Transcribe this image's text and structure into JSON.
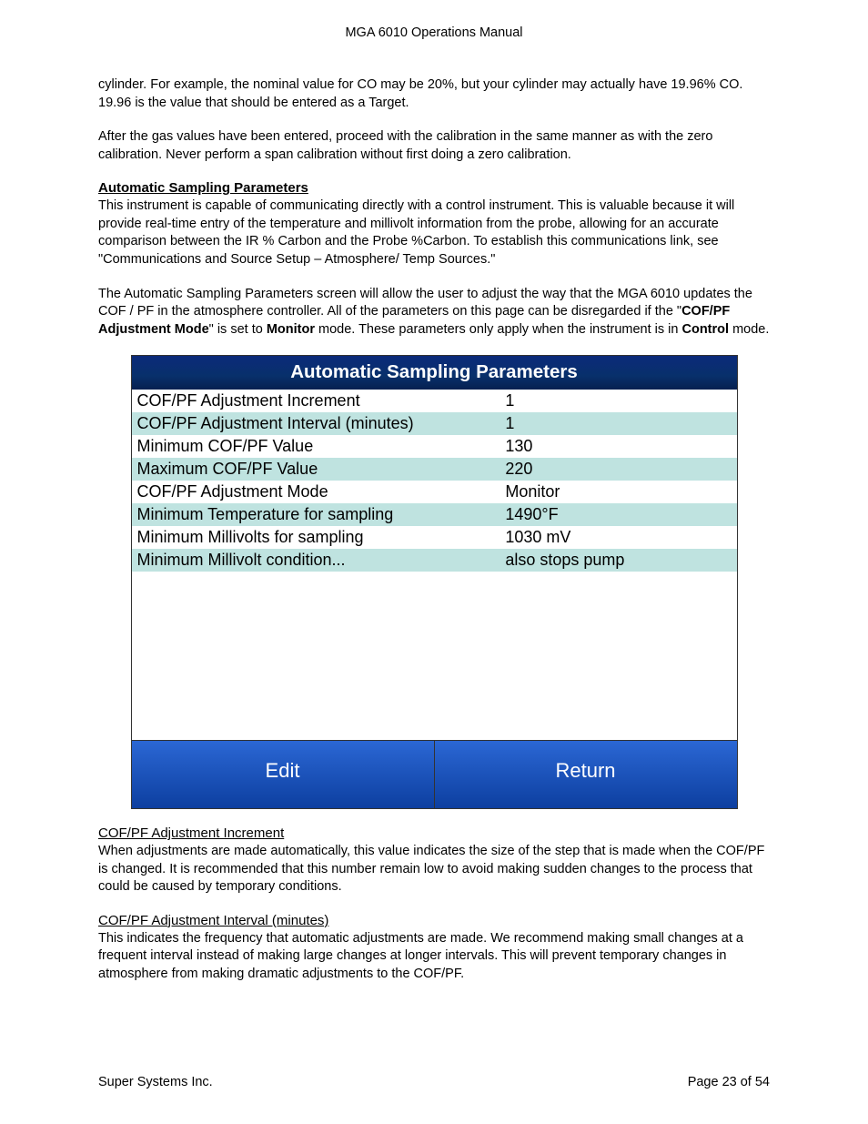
{
  "header": {
    "title": "MGA 6010 Operations Manual"
  },
  "body": {
    "para_top": "cylinder.  For example, the nominal value for CO may be 20%, but your cylinder may actually have 19.96% CO.  19.96 is the value that should be entered as a Target.",
    "para_after_gas": "After the gas values have been entered, proceed with the calibration in the same manner as with the zero calibration.  Never perform a span calibration without first doing a zero calibration.",
    "section_title": "Automatic Sampling Parameters",
    "para_intro1": "This instrument is capable of communicating directly with a control instrument.  This is valuable because it will provide real-time entry of the temperature and millivolt information from the probe, allowing for an accurate comparison between the IR % Carbon and the Probe %Carbon.  To establish this communications link, see \"Communications and Source Setup – Atmosphere/ Temp Sources.\"",
    "para_intro2_a": "The Automatic Sampling Parameters screen will allow the user to adjust the way that the MGA 6010 updates the COF / PF in the atmosphere controller.  All of the parameters on this page can be disregarded if the \"",
    "para_intro2_bold1": "COF/PF Adjustment Mode",
    "para_intro2_b": "\" is set to ",
    "para_intro2_bold2": "Monitor",
    "para_intro2_c": " mode.  These parameters only apply when the instrument is in ",
    "para_intro2_bold3": "Control",
    "para_intro2_d": " mode.",
    "sub1_title": "COF/PF Adjustment Increment",
    "sub1_text": "When adjustments are made automatically, this value indicates the size of the step that is made when the COF/PF is changed.  It is recommended that this number remain low to avoid making sudden changes to the process that could be caused by temporary conditions.",
    "sub2_title": "COF/PF Adjustment Interval (minutes)",
    "sub2_text": "This indicates the frequency that automatic adjustments are made.  We recommend making small changes at a frequent interval instead of making large changes at longer intervals.  This will prevent temporary changes in atmosphere from making dramatic adjustments to the COF/PF."
  },
  "screenshot": {
    "title": "Automatic Sampling Parameters",
    "rows": [
      {
        "label": "COF/PF Adjustment Increment",
        "value": "1"
      },
      {
        "label": "COF/PF Adjustment Interval (minutes)",
        "value": "1"
      },
      {
        "label": "Minimum COF/PF Value",
        "value": "130"
      },
      {
        "label": "Maximum COF/PF Value",
        "value": "220"
      },
      {
        "label": "COF/PF Adjustment  Mode",
        "value": "Monitor"
      },
      {
        "label": "Minimum Temperature for sampling",
        "value": "1490°F"
      },
      {
        "label": "Minimum Millivolts for sampling",
        "value": "1030 mV"
      },
      {
        "label": "Minimum Millivolt condition...",
        "value": "also stops pump"
      }
    ],
    "buttons": {
      "edit": "Edit",
      "return": "Return"
    }
  },
  "footer": {
    "left": "Super Systems Inc.",
    "right": "Page 23 of 54"
  }
}
